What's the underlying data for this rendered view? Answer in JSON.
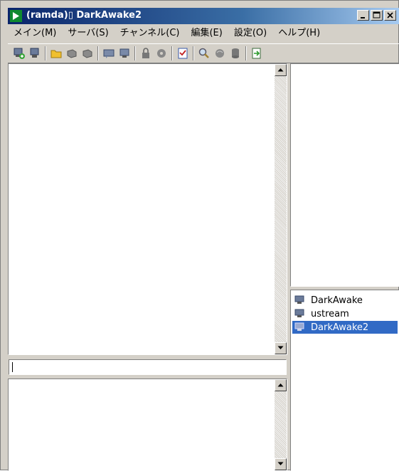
{
  "window": {
    "title": "(ramda)▯ DarkAwake2"
  },
  "menubar": {
    "items": [
      {
        "label": "メイン(M)"
      },
      {
        "label": "サーバ(S)"
      },
      {
        "label": "チャンネル(C)"
      },
      {
        "label": "編集(E)"
      },
      {
        "label": "設定(O)"
      },
      {
        "label": "ヘルプ(H)"
      }
    ]
  },
  "toolbar": {
    "icons": [
      "server-connect-icon",
      "server-icon",
      "folder-icon",
      "channel-join-icon",
      "channel-part-icon",
      "chat-icon",
      "monitor-icon",
      "lock-icon",
      "settings-icon",
      "checklist-icon",
      "search-icon",
      "globe-icon",
      "database-icon",
      "export-icon"
    ]
  },
  "input": {
    "value": ""
  },
  "channels": [
    {
      "name": "DarkAwake",
      "selected": false
    },
    {
      "name": "ustream",
      "selected": false
    },
    {
      "name": "DarkAwake2",
      "selected": true
    }
  ],
  "colors": {
    "titlebar_start": "#0a246a",
    "titlebar_end": "#a6caf0",
    "selection": "#316ac5",
    "window_bg": "#d4d0c8"
  }
}
